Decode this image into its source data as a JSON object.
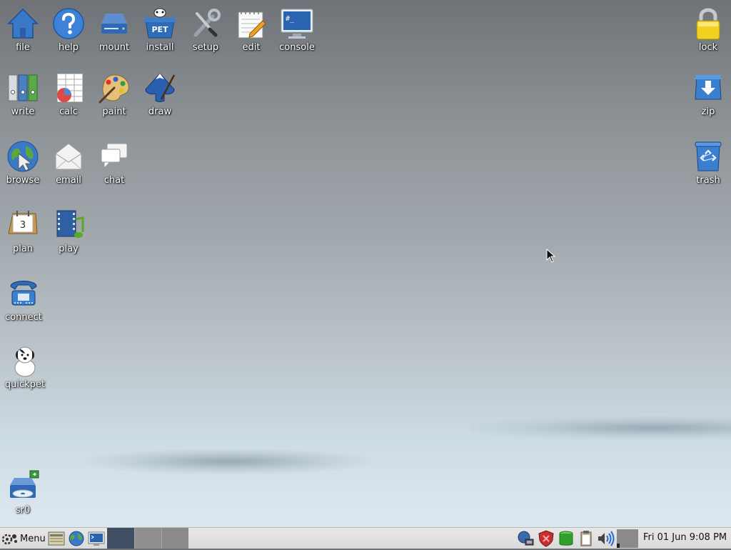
{
  "desktop": {
    "icons_left": [
      {
        "id": "file",
        "label": "file"
      },
      {
        "id": "help",
        "label": "help"
      },
      {
        "id": "mount",
        "label": "mount"
      },
      {
        "id": "install",
        "label": "install"
      },
      {
        "id": "setup",
        "label": "setup"
      },
      {
        "id": "edit",
        "label": "edit"
      },
      {
        "id": "console",
        "label": "console"
      },
      {
        "id": "write",
        "label": "write"
      },
      {
        "id": "calc",
        "label": "calc"
      },
      {
        "id": "paint",
        "label": "paint"
      },
      {
        "id": "draw",
        "label": "draw"
      },
      {
        "id": "browse",
        "label": "browse"
      },
      {
        "id": "email",
        "label": "email"
      },
      {
        "id": "chat",
        "label": "chat"
      },
      {
        "id": "plan",
        "label": "plan"
      },
      {
        "id": "play",
        "label": "play"
      },
      {
        "id": "connect",
        "label": "connect"
      },
      {
        "id": "quickpet",
        "label": "quickpet"
      },
      {
        "id": "sr0",
        "label": "sr0"
      }
    ],
    "icons_right": [
      {
        "id": "lock",
        "label": "lock"
      },
      {
        "id": "zip",
        "label": "zip"
      },
      {
        "id": "trash",
        "label": "trash"
      }
    ],
    "icon_glyph_text": {
      "install": "PET",
      "console": "#_",
      "plan": "3"
    }
  },
  "taskbar": {
    "menu_label": "Menu",
    "clock": "Fri 01 Jun  9:08 PM",
    "workspaces": [
      "workspace-1",
      "workspace-2",
      "workspace-3"
    ],
    "active_workspace": 1
  },
  "colors": {
    "taskbar_bg": "#dcdcdc",
    "workspace_active": "#3f4e63",
    "workspace_inactive": "#8a8a8a",
    "icon_label": "#ffffff"
  }
}
